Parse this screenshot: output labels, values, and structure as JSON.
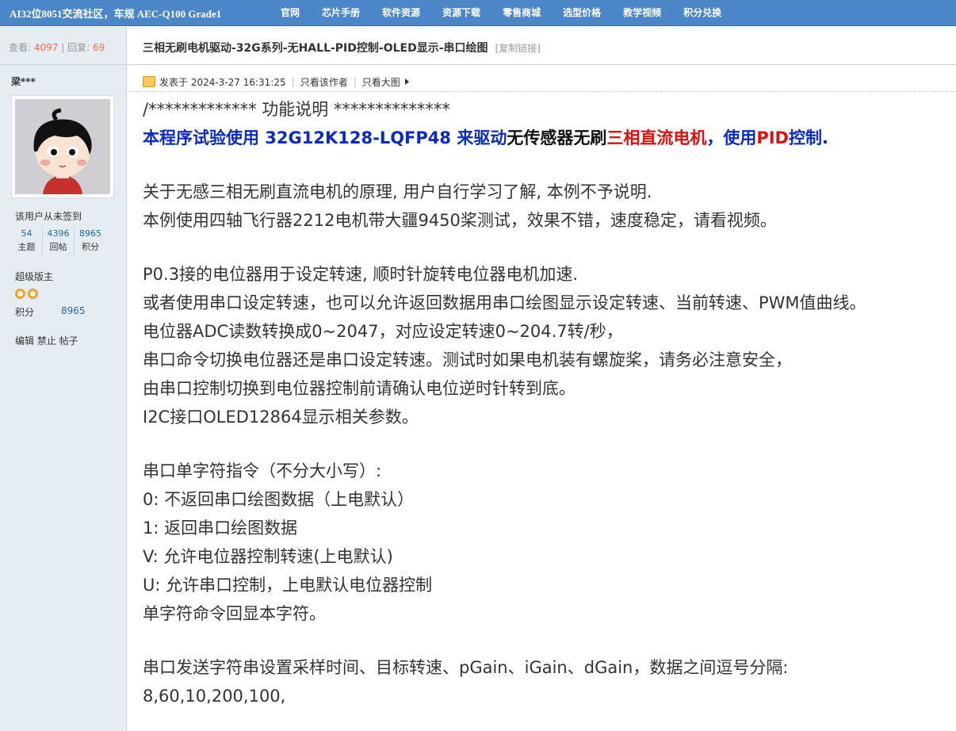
{
  "header": {
    "site_title": "AI32位8051交流社区，车规 AEC-Q100 Grade1",
    "nav": [
      "官网",
      "芯片手册",
      "软件资源",
      "资源下载",
      "零售商城",
      "选型价格",
      "教学视频",
      "积分兑换"
    ]
  },
  "sidebar": {
    "views_label": "查看:",
    "views_value": "4097",
    "sep": "|",
    "replies_label": "回复:",
    "replies_value": "69",
    "username": "梁***",
    "checkin": "该用户从未签到",
    "stats": [
      {
        "num": "54",
        "label": "主题"
      },
      {
        "num": "4396",
        "label": "回帖"
      },
      {
        "num": "8965",
        "label": "积分"
      }
    ],
    "rank": "超级版主",
    "points_label": "积分",
    "points_value": "8965",
    "admin_links": "编辑 禁止 帖子"
  },
  "post": {
    "title": "三相无刷电机驱动-32G系列-无HALL-PID控制-OLED显示-串口绘图",
    "copy_link": "[复制链接]",
    "posted": "发表于 2024-3-27 16:31:25",
    "only_author": "只看该作者",
    "only_big_image": "只看大图",
    "l01": "/*************          功能说明          **************",
    "l02_a": "本程序试验使用 32G12K128-LQFP48 来驱动",
    "l02_b": "无传感器无刷",
    "l02_c": "三相直流电机",
    "l02_d": "，使用",
    "l02_e": "PID",
    "l02_f": "控制.",
    "l03": "关于无感三相无刷直流电机的原理, 用户自行学习了解, 本例不予说明.",
    "l04": "本例使用四轴飞行器2212电机带大疆9450桨测试，效果不错，速度稳定，请看视频。",
    "l05": "P0.3接的电位器用于设定转速, 顺时针旋转电位器电机加速.",
    "l06": "或者使用串口设定转速，也可以允许返回数据用串口绘图显示设定转速、当前转速、PWM值曲线。",
    "l07": "电位器ADC读数转换成0~2047，对应设定转速0~204.7转/秒，",
    "l08": "串口命令切换电位器还是串口设定转速。测试时如果电机装有螺旋桨，请务必注意安全，",
    "l09": "由串口控制切换到电位器控制前请确认电位逆时针转到底。",
    "l10": "I2C接口OLED12864显示相关参数。",
    "l11": "串口单字符指令（不分大小写）:",
    "l12": "0:  不返回串口绘图数据（上电默认）",
    "l13": "1:     返回串口绘图数据",
    "l14": "V:  允许电位器控制转速(上电默认)",
    "l15": "U:          允许串口控制，上电默认电位器控制",
    "l16": "单字符命令回显本字符。",
    "l17": "串口发送字符串设置采样时间、目标转速、pGain、iGain、dGain，数据之间逗号分隔:",
    "l18": "8,60,10,200,100,"
  }
}
